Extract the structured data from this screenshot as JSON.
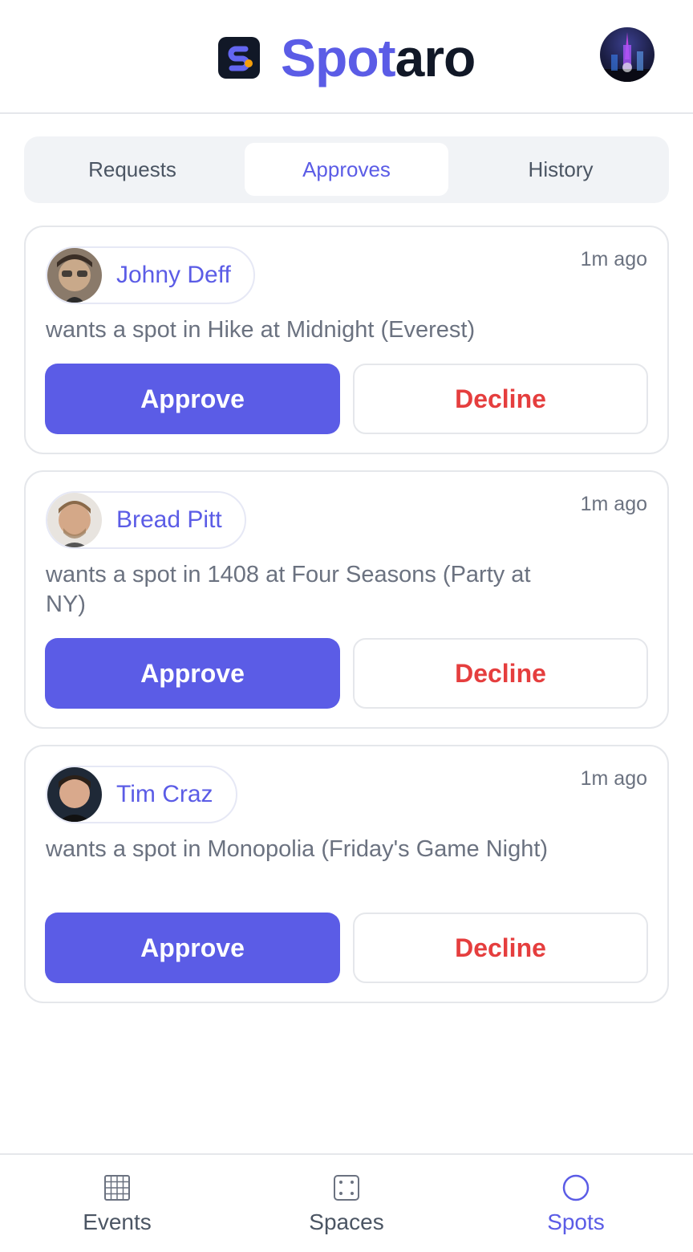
{
  "app": {
    "brand_part1": "Spot",
    "brand_part2": "aro",
    "accent_color": "#5b5ce6"
  },
  "tabs": [
    {
      "label": "Requests",
      "active": false
    },
    {
      "label": "Approves",
      "active": true
    },
    {
      "label": "History",
      "active": false
    }
  ],
  "requests": [
    {
      "name": "Johny Deff",
      "time": "1m ago",
      "text": "wants a spot in Hike at Midnight (Everest)",
      "approve_label": "Approve",
      "decline_label": "Decline"
    },
    {
      "name": "Bread Pitt",
      "time": "1m ago",
      "text": "wants a spot in 1408 at Four Seasons (Party at NY)",
      "approve_label": "Approve",
      "decline_label": "Decline"
    },
    {
      "name": "Tim Craz",
      "time": "1m ago",
      "text": "wants a spot in Monopolia (Friday's Game Night)",
      "approve_label": "Approve",
      "decline_label": "Decline"
    }
  ],
  "nav": [
    {
      "label": "Events",
      "icon": "grid-icon",
      "active": false
    },
    {
      "label": "Spaces",
      "icon": "dice-icon",
      "active": false
    },
    {
      "label": "Spots",
      "icon": "circle-icon",
      "active": true
    }
  ]
}
